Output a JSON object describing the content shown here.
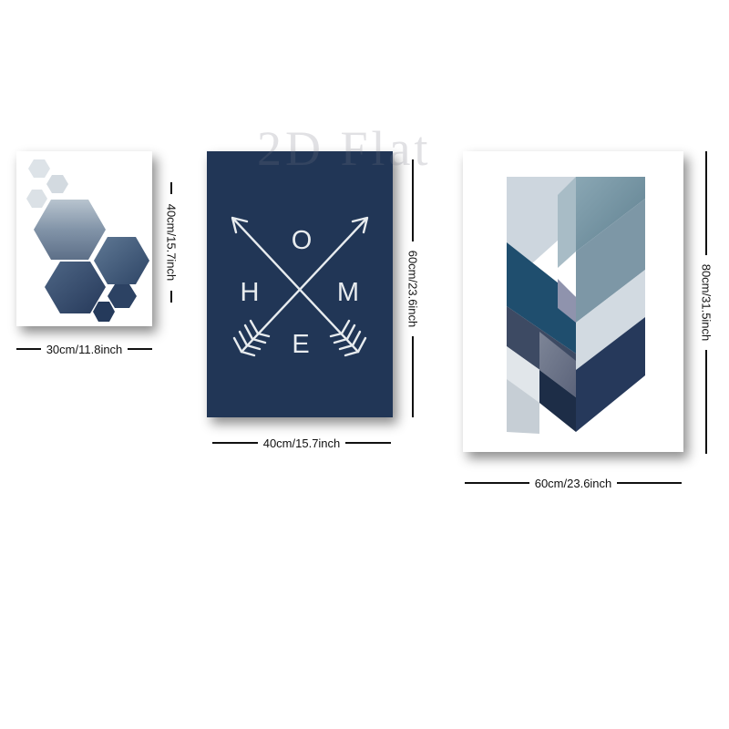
{
  "watermark": {
    "text": "2D Flat"
  },
  "panels": [
    {
      "name": "hexagon-canvas",
      "width_label": "30cm/11.8inch",
      "height_label": "40cm/15.7inch"
    },
    {
      "name": "home-arrows-canvas",
      "letters": {
        "top": "O",
        "left": "H",
        "right": "M",
        "bottom": "E"
      },
      "width_label": "40cm/15.7inch",
      "height_label": "60cm/23.6inch"
    },
    {
      "name": "geometric-chevron-canvas",
      "width_label": "60cm/23.6inch",
      "height_label": "80cm/31.5inch"
    }
  ],
  "colors": {
    "navy": "#213656",
    "light_gray_blue": "#cfd8df",
    "dim_text": "#111111"
  }
}
